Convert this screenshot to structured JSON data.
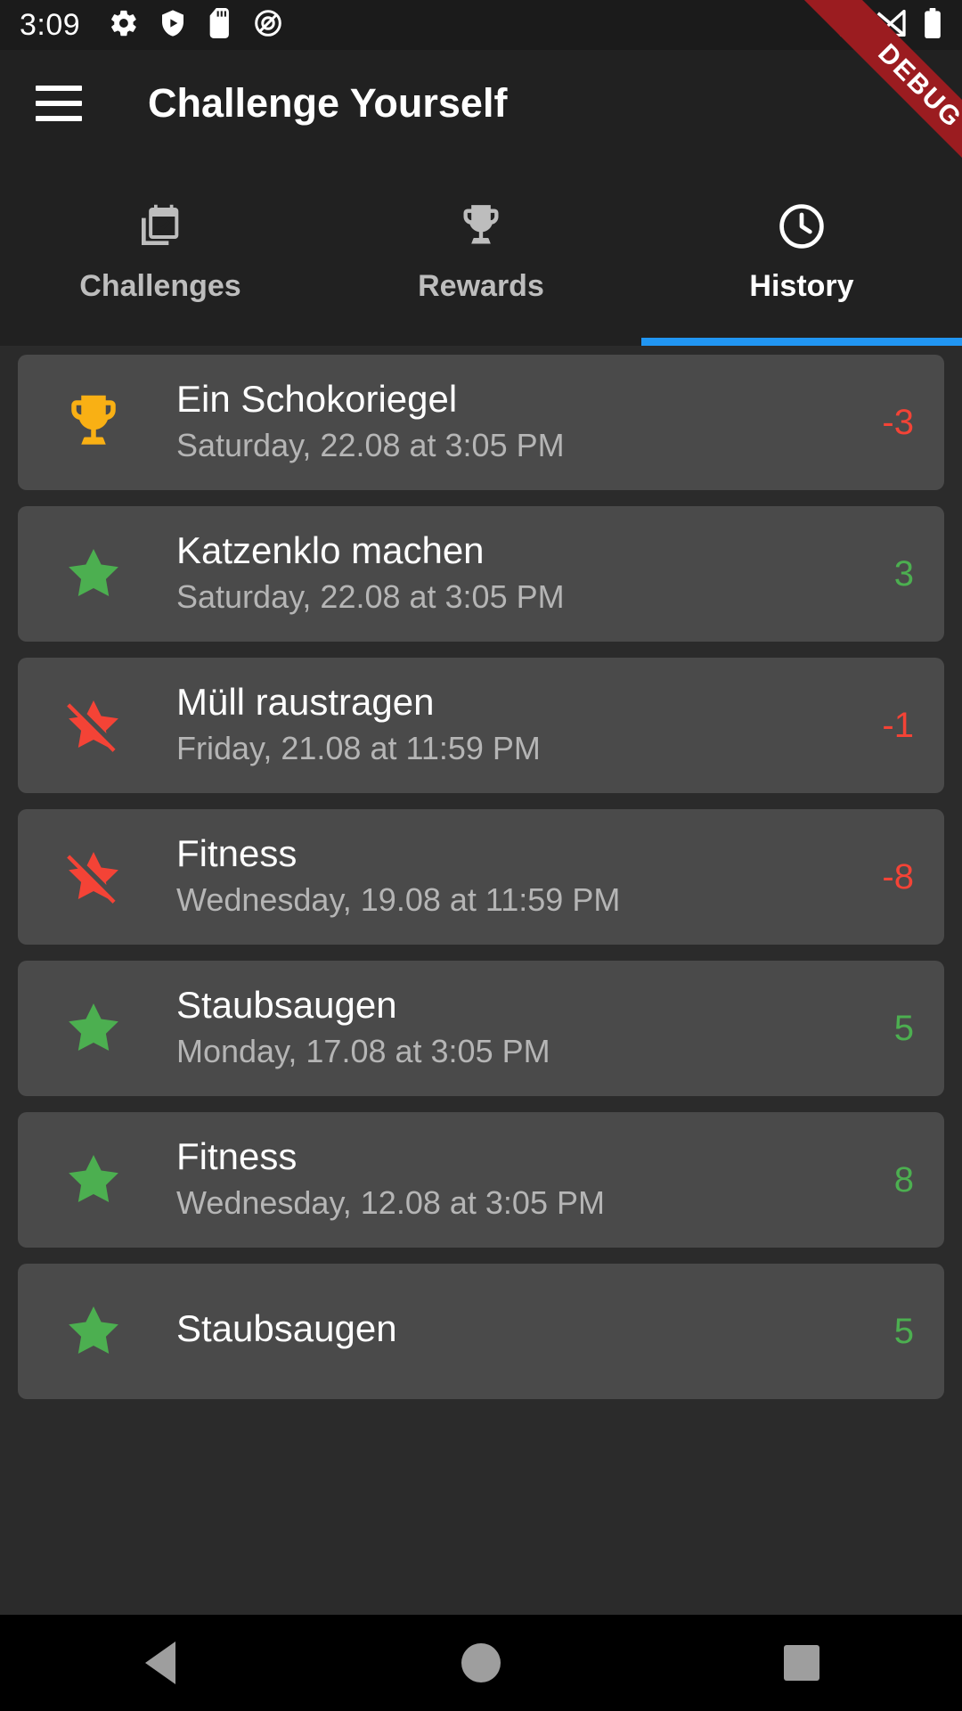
{
  "status_bar": {
    "time": "3:09",
    "left_icons": [
      "gear-icon",
      "shield-play-icon",
      "sd-card-icon",
      "no-ads-icon"
    ],
    "right_icons": [
      "wifi-icon",
      "signal-off-icon",
      "battery-icon"
    ]
  },
  "debug_banner": {
    "label": "DEBUG",
    "color": "#9b1c20"
  },
  "app_bar": {
    "menu_icon": "hamburger-menu-icon",
    "title": "Challenge Yourself"
  },
  "tabs": {
    "active_index": 2,
    "indicator_color": "#2196f3",
    "items": [
      {
        "label": "Challenges",
        "icon": "calendar-check-icon",
        "active": false
      },
      {
        "label": "Rewards",
        "icon": "trophy-icon",
        "active": false
      },
      {
        "label": "History",
        "icon": "clock-icon",
        "active": true
      }
    ]
  },
  "colors": {
    "positive": "#4caf50",
    "negative": "#f44336",
    "trophy": "#f9b014",
    "card_bg": "#4a4a4a",
    "page_bg": "#2b2b2b",
    "app_bar_bg": "#212121"
  },
  "history": {
    "items": [
      {
        "icon": "trophy-icon",
        "title": "Ein Schokoriegel",
        "subtitle": "Saturday, 22.08 at 3:05 PM",
        "value": "-3",
        "sign": "negative"
      },
      {
        "icon": "star-icon",
        "title": "Katzenklo machen",
        "subtitle": "Saturday, 22.08 at 3:05 PM",
        "value": "3",
        "sign": "positive"
      },
      {
        "icon": "star-off-icon",
        "title": "Müll raustragen",
        "subtitle": "Friday, 21.08 at 11:59 PM",
        "value": "-1",
        "sign": "negative"
      },
      {
        "icon": "star-off-icon",
        "title": "Fitness",
        "subtitle": "Wednesday, 19.08 at 11:59 PM",
        "value": "-8",
        "sign": "negative"
      },
      {
        "icon": "star-icon",
        "title": "Staubsaugen",
        "subtitle": "Monday, 17.08 at 3:05 PM",
        "value": "5",
        "sign": "positive"
      },
      {
        "icon": "star-icon",
        "title": "Fitness",
        "subtitle": "Wednesday, 12.08 at 3:05 PM",
        "value": "8",
        "sign": "positive"
      },
      {
        "icon": "star-icon",
        "title": "Staubsaugen",
        "subtitle": "",
        "value": "5",
        "sign": "positive"
      }
    ]
  },
  "nav_bar": {
    "back": "back-triangle-icon",
    "home": "home-circle-icon",
    "recents": "recents-square-icon"
  }
}
